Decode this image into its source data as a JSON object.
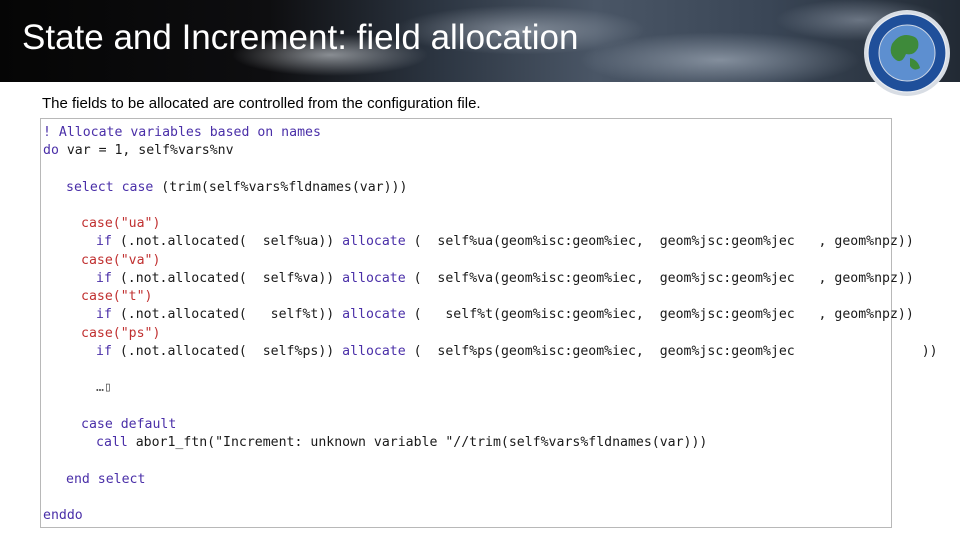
{
  "slide": {
    "title": "State and Increment: field allocation",
    "intro": "The fields to be allocated are controlled from the configuration file."
  },
  "code": {
    "comment": "! Allocate variables based on names",
    "do_kw": "do",
    "do_rest": " var = 1, self%vars%nv",
    "select_kw": "select case",
    "select_rest": " (trim(self%vars%fldnames(var)))",
    "cases": [
      {
        "label": "case(\"ua\")",
        "if_kw": "if",
        "cond": " (.not.allocated(  self%ua))",
        "alloc_kw": " allocate",
        "alloc_args": " (  self%ua(geom%isc:geom%iec,  geom%jsc:geom%jec   , geom%npz))"
      },
      {
        "label": "case(\"va\")",
        "if_kw": "if",
        "cond": " (.not.allocated(  self%va))",
        "alloc_kw": " allocate",
        "alloc_args": " (  self%va(geom%isc:geom%iec,  geom%jsc:geom%jec   , geom%npz))"
      },
      {
        "label": "case(\"t\")",
        "if_kw": "if",
        "cond": " (.not.allocated(   self%t))",
        "alloc_kw": " allocate",
        "alloc_args": " (   self%t(geom%isc:geom%iec,  geom%jsc:geom%jec   , geom%npz))"
      },
      {
        "label": "case(\"ps\")",
        "if_kw": "if",
        "cond": " (.not.allocated(  self%ps))",
        "alloc_kw": " allocate",
        "alloc_args": " (  self%ps(geom%isc:geom%iec,  geom%jsc:geom%jec                ))"
      }
    ],
    "ellipsis": "…▯",
    "default_kw": "case default",
    "call_kw": "call",
    "call_rest": " abor1_ftn(\"Increment: unknown variable \"//trim(self%vars%fldnames(var)))",
    "end_select": "end select",
    "enddo": "enddo"
  }
}
